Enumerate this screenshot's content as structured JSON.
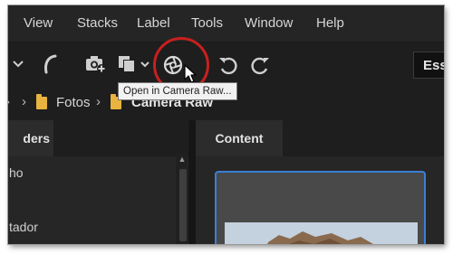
{
  "menubar": {
    "items": [
      "View",
      "Stacks",
      "Label",
      "Tools",
      "Window",
      "Help"
    ]
  },
  "toolbar": {
    "icons": [
      "chevron-down-icon",
      "boomerang-icon",
      "camera-import-icon",
      "copy-output-icon",
      "camera-raw-aperture-icon",
      "rotate-left-icon",
      "rotate-right-icon"
    ],
    "workspace_label": "Ess"
  },
  "tooltip": {
    "text": "Open in Camera Raw..."
  },
  "breadcrumb": {
    "items": [
      "Fotos",
      "Camera Raw"
    ]
  },
  "left_panel": {
    "tab_label": "ders",
    "tree_items": [
      "ho",
      "tador"
    ]
  },
  "content_panel": {
    "tab_label": "Content"
  },
  "colors": {
    "background": "#1e1e1e",
    "highlight_ring": "#c8201e",
    "selection": "#3a7fd6",
    "folder": "#e8b33f"
  }
}
